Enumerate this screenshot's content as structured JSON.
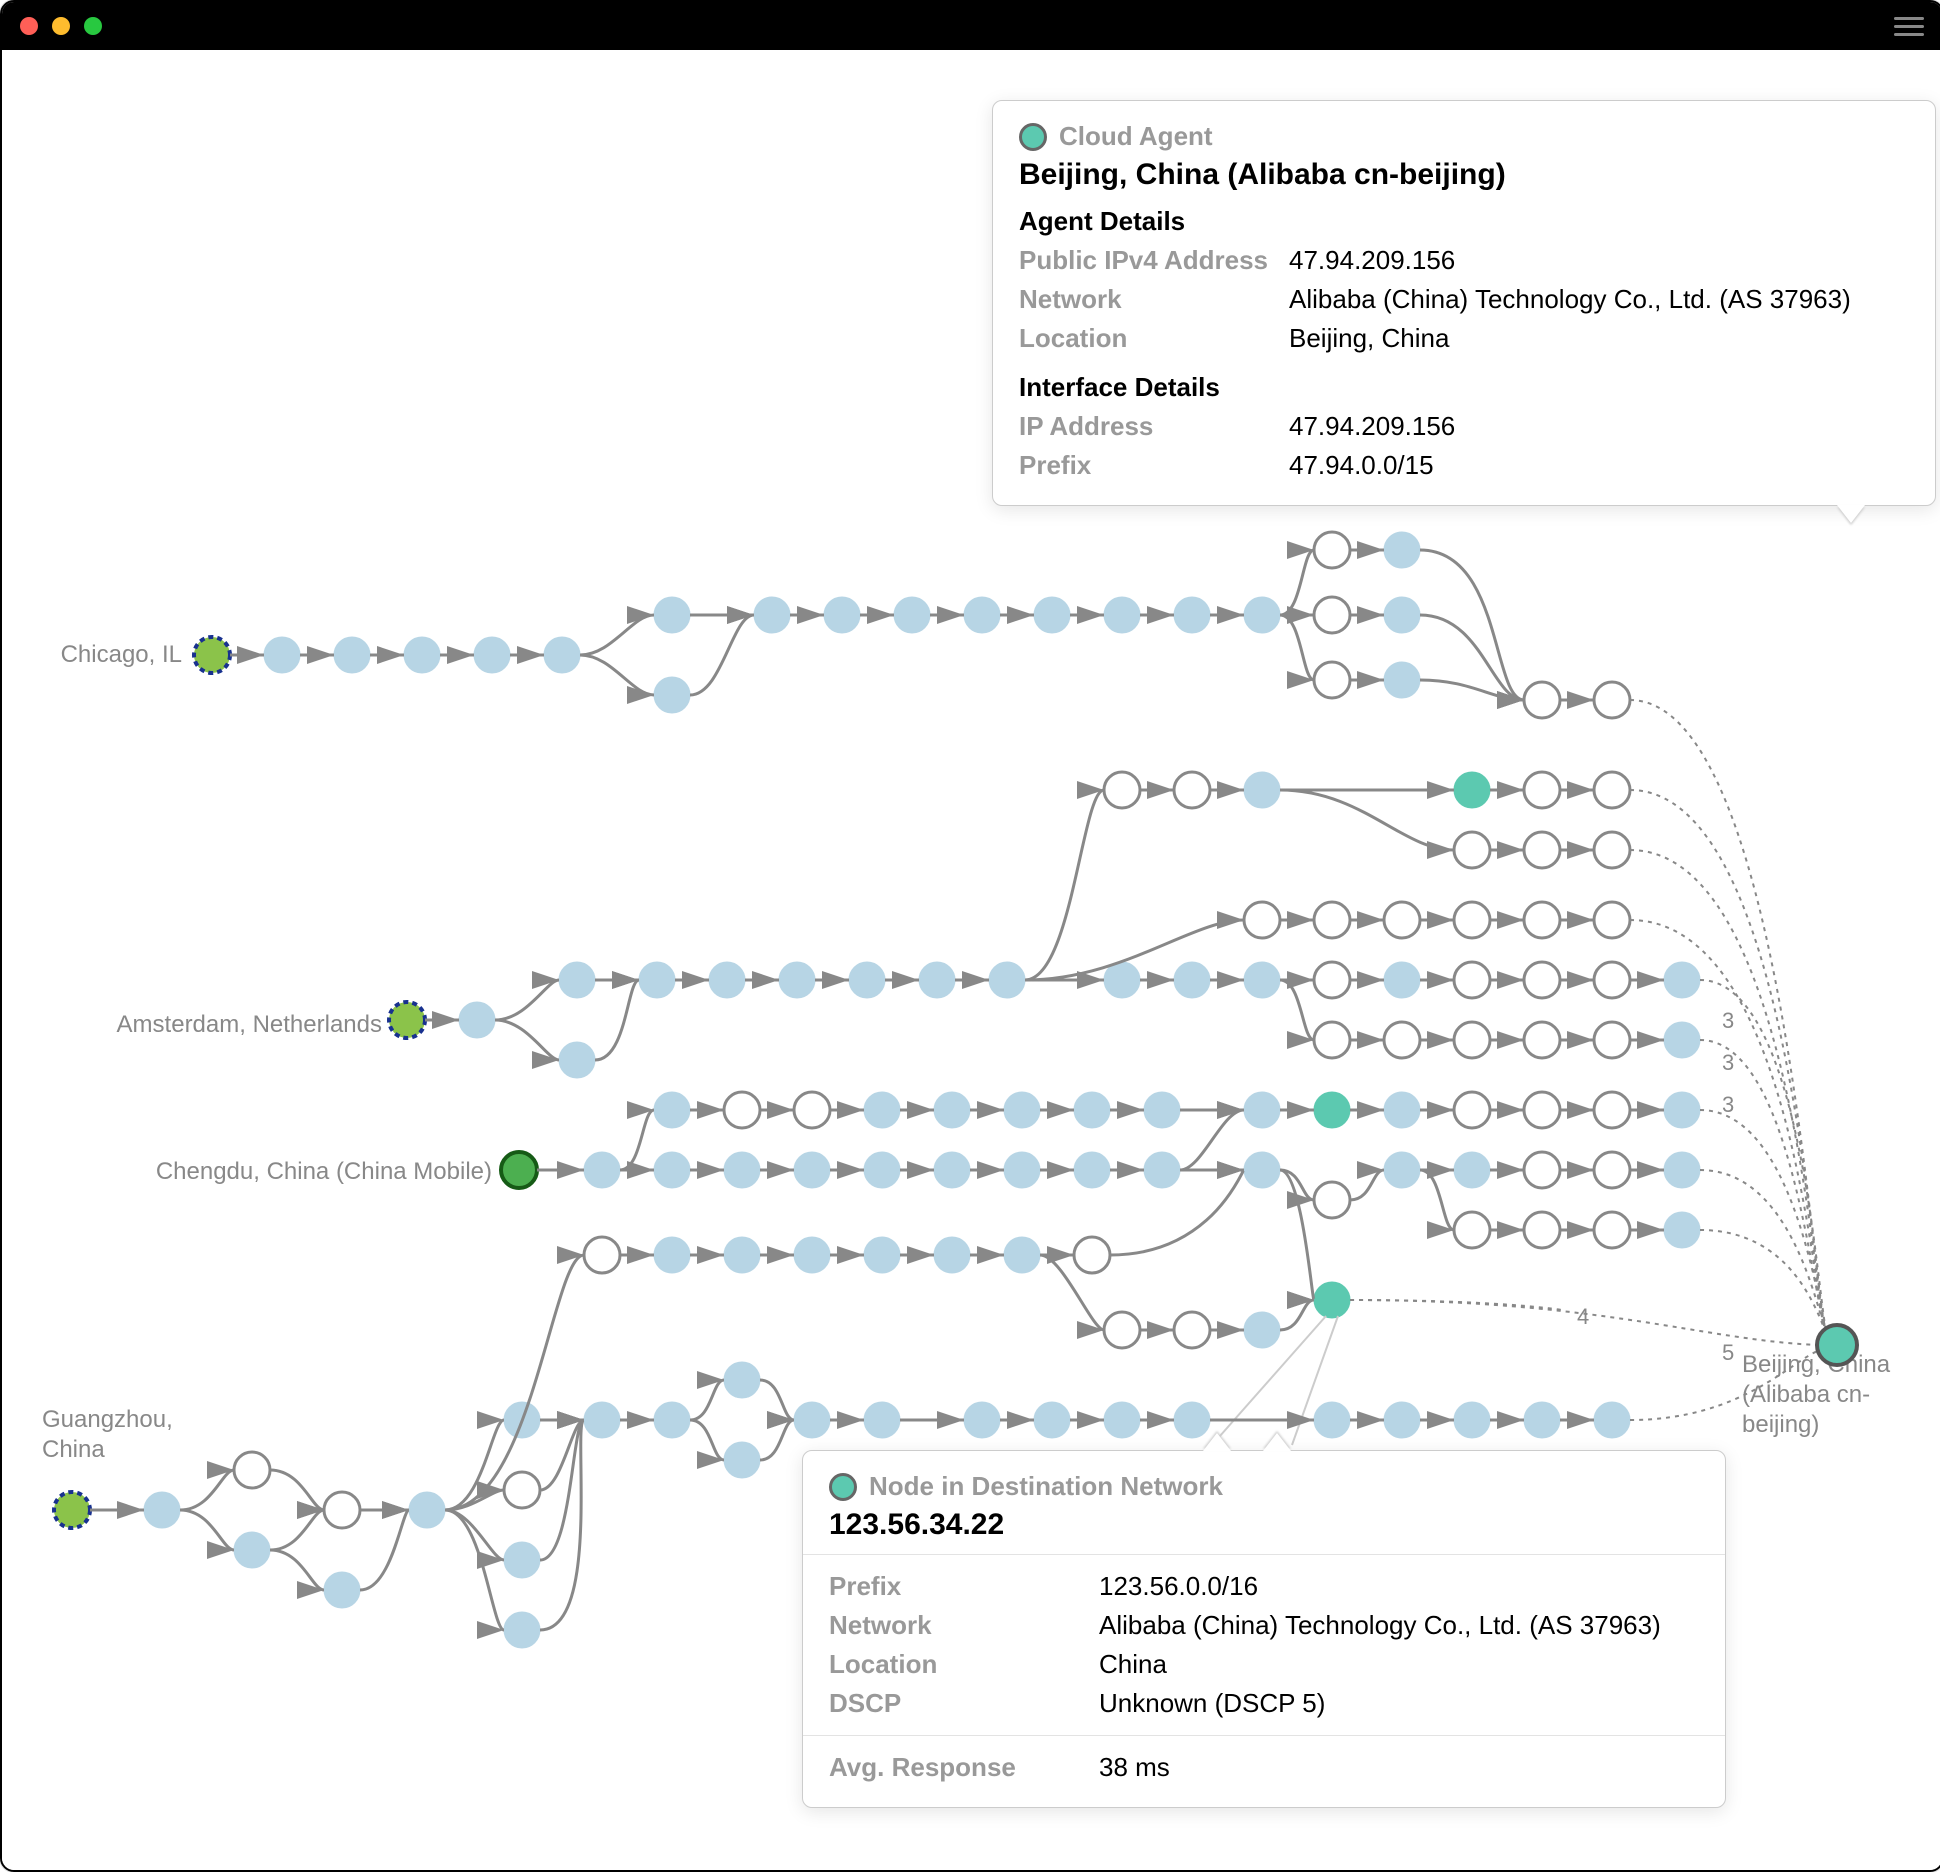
{
  "agents": [
    {
      "label": "Chicago, IL"
    },
    {
      "label": "Amsterdam, Netherlands"
    },
    {
      "label": "Chengdu, China (China Mobile)"
    },
    {
      "label": "Guangzhou,\nChina"
    }
  ],
  "destination": {
    "label": "Beijing, China\n(Alibaba cn-beijing)"
  },
  "edge_counts": {
    "a": "3",
    "b": "3",
    "c": "3",
    "d": "4",
    "e": "5"
  },
  "tooltip_top": {
    "type": "Cloud Agent",
    "title": "Beijing, China (Alibaba cn-beijing)",
    "section1": "Agent Details",
    "rows1": [
      {
        "k": "Public IPv4 Address",
        "v": "47.94.209.156"
      },
      {
        "k": "Network",
        "v": "Alibaba (China) Technology Co., Ltd. (AS 37963)"
      },
      {
        "k": "Location",
        "v": "Beijing, China"
      }
    ],
    "section2": "Interface Details",
    "rows2": [
      {
        "k": "IP Address",
        "v": "47.94.209.156"
      },
      {
        "k": "Prefix",
        "v": "47.94.0.0/15"
      }
    ]
  },
  "tooltip_bottom": {
    "type": "Node in Destination Network",
    "title": "123.56.34.22",
    "rows": [
      {
        "k": "Prefix",
        "v": "123.56.0.0/16"
      },
      {
        "k": "Network",
        "v": "Alibaba (China) Technology Co., Ltd. (AS 37963)"
      },
      {
        "k": "Location",
        "v": "China"
      },
      {
        "k": "DSCP",
        "v": "Unknown (DSCP 5)"
      }
    ],
    "response_k": "Avg. Response",
    "response_v": "38 ms"
  }
}
